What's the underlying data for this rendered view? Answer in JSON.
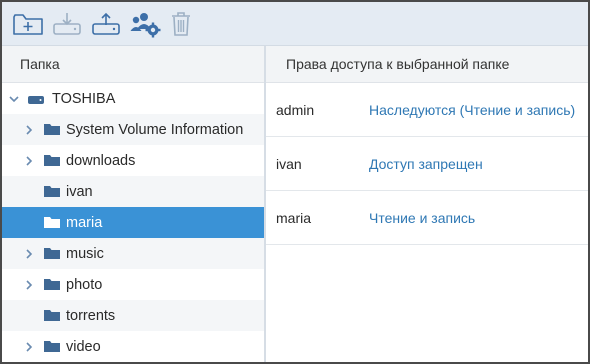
{
  "toolbar": {
    "buttons": [
      {
        "name": "add-folder-button",
        "icon": "add-folder-icon"
      },
      {
        "name": "download-button",
        "icon": "download-icon",
        "disabled": true
      },
      {
        "name": "upload-button",
        "icon": "upload-icon"
      },
      {
        "name": "users-settings-button",
        "icon": "users-gear-icon"
      },
      {
        "name": "delete-button",
        "icon": "trash-icon",
        "disabled": true
      }
    ]
  },
  "tree": {
    "header": "Папка",
    "root": {
      "label": "TOSHIBA",
      "icon": "drive-icon",
      "expanded": true
    },
    "items": [
      {
        "label": "System Volume Information",
        "has_children": true
      },
      {
        "label": "downloads",
        "has_children": true
      },
      {
        "label": "ivan",
        "has_children": false
      },
      {
        "label": "maria",
        "has_children": false,
        "selected": true
      },
      {
        "label": "music",
        "has_children": true
      },
      {
        "label": "photo",
        "has_children": true
      },
      {
        "label": "torrents",
        "has_children": false
      },
      {
        "label": "video",
        "has_children": true
      }
    ]
  },
  "permissions": {
    "header": "Права доступа к выбранной папке",
    "rows": [
      {
        "user": "admin",
        "access": "Наследуются (Чтение и запись)"
      },
      {
        "user": "ivan",
        "access": "Доступ запрещен"
      },
      {
        "user": "maria",
        "access": "Чтение и запись"
      }
    ]
  },
  "colors": {
    "accent": "#3a92d6",
    "link": "#2f78b4",
    "icon": "#3d6fa8",
    "folder": "#3f6894",
    "toolbar_bg": "#e4ebf3"
  }
}
